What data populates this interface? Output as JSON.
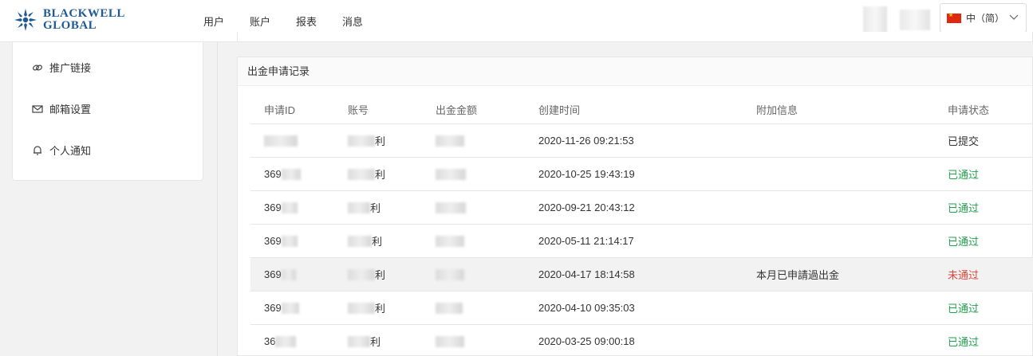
{
  "brand": {
    "line1": "BLACKWELL",
    "line2": "GLOBAL"
  },
  "nav": {
    "items": [
      "用户",
      "账户",
      "报表",
      "消息"
    ]
  },
  "language": {
    "label": "中（简）"
  },
  "sidebar": {
    "items": [
      {
        "label": "推广链接",
        "icon": "link-icon"
      },
      {
        "label": "邮箱设置",
        "icon": "mail-icon"
      },
      {
        "label": "个人通知",
        "icon": "bell-icon"
      }
    ]
  },
  "withdrawals": {
    "title": "出金申请记录",
    "columns": [
      "申请ID",
      "账号",
      "出金金额",
      "创建时间",
      "附加信息",
      "申请状态"
    ],
    "rows": [
      {
        "id": "",
        "account": "利",
        "amount": "",
        "created": "2020-11-26 09:21:53",
        "extra": "",
        "status": "已提交"
      },
      {
        "id": "369",
        "account": "利",
        "amount": "",
        "created": "2020-10-25 19:43:19",
        "extra": "",
        "status": "已通过"
      },
      {
        "id": "369",
        "account": "利",
        "amount": "",
        "created": "2020-09-21 20:43:12",
        "extra": "",
        "status": "已通过"
      },
      {
        "id": "369",
        "account": "利",
        "amount": "",
        "created": "2020-05-11 21:14:17",
        "extra": "",
        "status": "已通过"
      },
      {
        "id": "369",
        "account": "利",
        "amount": "",
        "created": "2020-04-17 18:14:58",
        "extra": "本月已申請過出金",
        "status": "未通过"
      },
      {
        "id": "369",
        "account": "利",
        "amount": "",
        "created": "2020-04-10 09:35:03",
        "extra": "",
        "status": "已通过"
      },
      {
        "id": "36",
        "account": "利",
        "amount": "",
        "created": "2020-03-25 09:00:18",
        "extra": "",
        "status": "已通过"
      }
    ]
  },
  "colors": {
    "pass": "#21a04a",
    "fail": "#e0453a",
    "brand": "#1f5a96"
  }
}
